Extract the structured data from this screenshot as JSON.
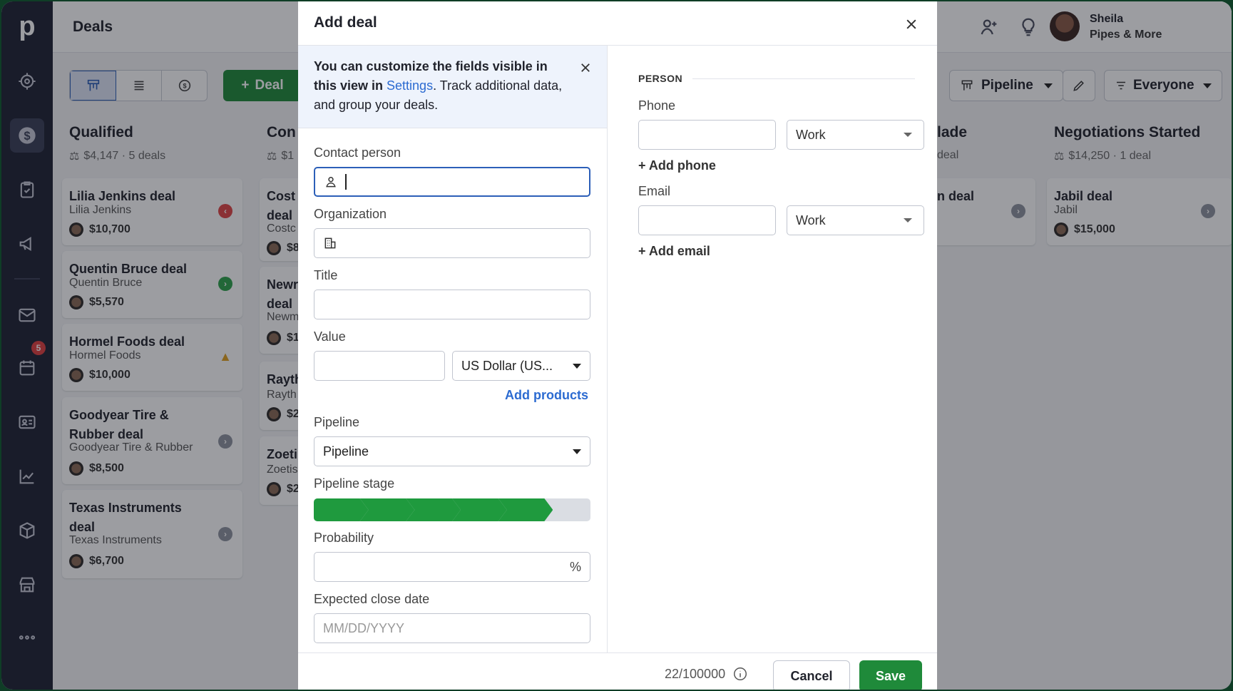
{
  "app": {
    "title": "Deals",
    "logo": "p"
  },
  "user": {
    "name": "Sheila",
    "company": "Pipes & More"
  },
  "toolbar": {
    "deal_button": "Deal",
    "pipeline_button": "Pipeline",
    "everyone_button": "Everyone"
  },
  "rail": {
    "inbox_badge": "5"
  },
  "columns": [
    {
      "title": "Qualified",
      "summary": "$4,147 · 5 deals"
    },
    {
      "title": "Con",
      "summary": "$1"
    },
    {
      "title": "lade",
      "summary": "deal"
    },
    {
      "title": "Negotiations Started",
      "summary": "$14,250 · 1 deal"
    }
  ],
  "qualified_cards": [
    {
      "title": "Lilia Jenkins deal",
      "org": "Lilia Jenkins",
      "value": "$10,700"
    },
    {
      "title": "Quentin Bruce deal",
      "org": "Quentin Bruce",
      "value": "$5,570"
    },
    {
      "title": "Hormel Foods deal",
      "org": "Hormel Foods",
      "value": "$10,000"
    },
    {
      "title": "Goodyear Tire & Rubber deal",
      "org": "Goodyear Tire & Rubber",
      "value": "$8,500"
    },
    {
      "title": "Texas Instruments deal",
      "org": "Texas Instruments",
      "value": "$6,700"
    }
  ],
  "contact_cards": [
    {
      "title": "Cost deal",
      "org": "Costc",
      "value": "$8"
    },
    {
      "title": "Newr deal",
      "org": "Newm",
      "value": "$1"
    },
    {
      "title": "Rayth",
      "org": "Rayth",
      "value": "$2"
    },
    {
      "title": "Zoeti",
      "org": "Zoetis",
      "value": "$2"
    }
  ],
  "made_card": {
    "title": "n deal"
  },
  "negotiation_cards": [
    {
      "title": "Jabil deal",
      "org": "Jabil",
      "value": "$15,000"
    }
  ],
  "modal": {
    "title": "Add deal",
    "banner": {
      "part1": "You can customize the fields visible in this view in ",
      "link": "Settings",
      "part2": ". Track additional data, and group your deals."
    },
    "contact_label": "Contact person",
    "organization_label": "Organization",
    "title_label": "Title",
    "value_label": "Value",
    "currency": "US Dollar (US...",
    "add_products": "Add products",
    "pipeline_label": "Pipeline",
    "pipeline_value": "Pipeline",
    "stage_label": "Pipeline stage",
    "stage_progress": {
      "completed": 5,
      "total": 6
    },
    "probability_label": "Probability",
    "probability_unit": "%",
    "close_date_label": "Expected close date",
    "close_date_placeholder": "MM/DD/YYYY",
    "person_section": "PERSON",
    "phone_label": "Phone",
    "phone_type": "Work",
    "add_phone": "+ Add phone",
    "email_label": "Email",
    "email_type": "Work",
    "add_email": "+ Add email",
    "counter": "22/100000",
    "cancel": "Cancel",
    "save": "Save"
  },
  "colors": {
    "accent_green": "#1f8a3a",
    "stage_green": "#1f9a3e",
    "link_blue": "#2c6bd1",
    "sidebar": "#1e2233"
  }
}
